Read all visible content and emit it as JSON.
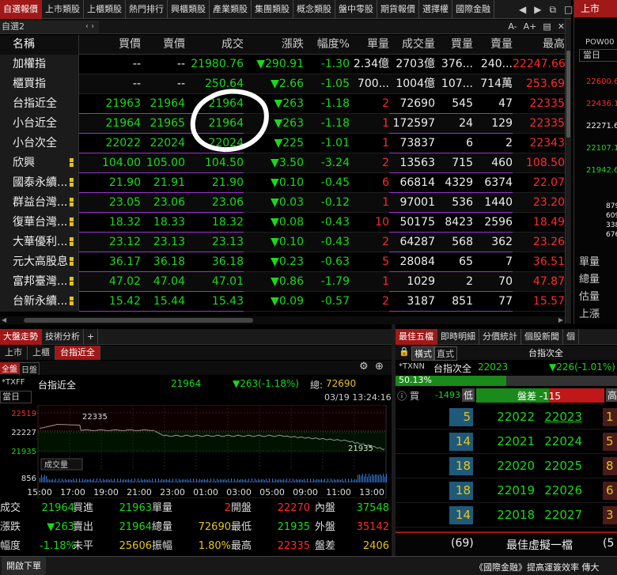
{
  "top_tabs": [
    "自選報價",
    "上市類股",
    "上櫃類股",
    "熱門排行",
    "興櫃類股",
    "產業類股",
    "集團類股",
    "概念類股",
    "盤中零股",
    "期貨報價",
    "選擇權",
    "國際金融"
  ],
  "top_controls": [
    "◀",
    "▶",
    "⧉",
    "□",
    "✕"
  ],
  "sub": {
    "selector": "自選2",
    "nav": "‹ ›",
    "zoom_minus": "A-",
    "zoom_plus": "A+",
    "tools": "▤",
    "close": "✕"
  },
  "quote": {
    "headers": [
      "名稱",
      "買價",
      "賣價",
      "成交",
      "漲跌",
      "幅度%",
      "單量",
      "成交量",
      "買量",
      "賣量",
      "最高"
    ],
    "rows": [
      {
        "name": "加權指",
        "bid": "--",
        "ask": "--",
        "last": "21980.76",
        "chg": "▼290.91",
        "pct": "-1.30",
        "vol": "2.34億",
        "tvol": "2703億",
        "bsz": "376...",
        "asz": "240...",
        "hi": "22247.66",
        "flag": false
      },
      {
        "name": "櫃買指",
        "bid": "--",
        "ask": "--",
        "last": "250.64",
        "chg": "▼2.66",
        "pct": "-1.05",
        "vol": "700...",
        "tvol": "1004億",
        "bsz": "107...",
        "asz": "714萬",
        "hi": "253.69",
        "flag": false
      },
      {
        "name": "台指近全",
        "bid": "21963",
        "ask": "21964",
        "last": "21964",
        "chg": "▼263",
        "pct": "-1.18",
        "vol": "2",
        "tvol": "72690",
        "bsz": "545",
        "asz": "47",
        "hi": "22335",
        "flag": false
      },
      {
        "name": "小台近全",
        "bid": "21964",
        "ask": "21965",
        "last": "21964",
        "chg": "▼263",
        "pct": "-1.18",
        "vol": "1",
        "tvol": "172597",
        "bsz": "24",
        "asz": "129",
        "hi": "22335",
        "flag": false
      },
      {
        "name": "小台次全",
        "bid": "22022",
        "ask": "22024",
        "last": "22024",
        "chg": "▼225",
        "pct": "-1.01",
        "vol": "1",
        "tvol": "73837",
        "bsz": "6",
        "asz": "2",
        "hi": "22343",
        "flag": false
      },
      {
        "name": "欣興",
        "bid": "104.00",
        "ask": "105.00",
        "last": "104.50",
        "chg": "▼3.50",
        "pct": "-3.24",
        "vol": "2",
        "tvol": "13563",
        "bsz": "715",
        "asz": "460",
        "hi": "108.50",
        "flag": true
      },
      {
        "name": "國泰永續...",
        "bid": "21.90",
        "ask": "21.91",
        "last": "21.90",
        "chg": "▼0.10",
        "pct": "-0.45",
        "vol": "6",
        "tvol": "66814",
        "bsz": "4329",
        "asz": "6374",
        "hi": "22.07",
        "flag": true
      },
      {
        "name": "群益台灣...",
        "bid": "23.05",
        "ask": "23.06",
        "last": "23.06",
        "chg": "▼0.03",
        "pct": "-0.12",
        "vol": "1",
        "tvol": "97001",
        "bsz": "536",
        "asz": "1440",
        "hi": "23.20",
        "flag": true
      },
      {
        "name": "復華台灣...",
        "bid": "18.32",
        "ask": "18.33",
        "last": "18.32",
        "chg": "▼0.08",
        "pct": "-0.43",
        "vol": "10",
        "tvol": "50175",
        "bsz": "8423",
        "asz": "2596",
        "hi": "18.49",
        "flag": true
      },
      {
        "name": "大華優利...",
        "bid": "23.12",
        "ask": "23.13",
        "last": "23.13",
        "chg": "▼0.10",
        "pct": "-0.43",
        "vol": "2",
        "tvol": "64287",
        "bsz": "568",
        "asz": "362",
        "hi": "23.26",
        "flag": true
      },
      {
        "name": "元大高股息",
        "bid": "36.17",
        "ask": "36.18",
        "last": "36.18",
        "chg": "▼0.23",
        "pct": "-0.63",
        "vol": "5",
        "tvol": "28084",
        "bsz": "65",
        "asz": "7",
        "hi": "36.51",
        "flag": true
      },
      {
        "name": "富邦臺灣...",
        "bid": "47.02",
        "ask": "47.04",
        "last": "47.01",
        "chg": "▼0.86",
        "pct": "-1.79",
        "vol": "1",
        "tvol": "1029",
        "bsz": "2",
        "asz": "70",
        "hi": "47.87",
        "flag": true
      },
      {
        "name": "台新永續...",
        "bid": "15.42",
        "ask": "15.44",
        "last": "15.43",
        "chg": "▼0.09",
        "pct": "-0.57",
        "vol": "2",
        "tvol": "3187",
        "bsz": "851",
        "asz": "77",
        "hi": "15.57",
        "flag": true
      }
    ]
  },
  "right_panel": {
    "tab": "上市",
    "code": "POW00",
    "period": "當日",
    "prices": [
      "22600.6",
      "22436.1",
      "22271.6",
      "22107.1",
      "21942.6"
    ],
    "small_prices": [
      "879",
      "609",
      "338",
      "676"
    ],
    "labels": [
      "單量",
      "總量",
      "估量",
      "上漲"
    ]
  },
  "lower_left": {
    "tabs": [
      "大盤走勢",
      "技術分析",
      "+"
    ],
    "sub_tabs": [
      "上市",
      "上櫃",
      "台指近全"
    ],
    "sub2": [
      "全盤",
      "日盤"
    ],
    "sym": "*TXFF",
    "period": "當日",
    "name": "台指近全",
    "last": "21964",
    "chg": "▼263(-1.18%)",
    "total_label": "總:",
    "total": "72690",
    "datetime": "03/19  13:24:16",
    "y_labels": [
      "22519",
      "22227",
      "21935",
      "856"
    ],
    "peak_label": "22335",
    "low_label": "21935",
    "vol_label": "成交量",
    "time_labels": [
      "15:00",
      "17:00",
      "19:00",
      "21:00",
      "23:00",
      "01:00",
      "03:00",
      "05:00",
      "09:00",
      "11:00",
      "13:00"
    ],
    "stats": [
      [
        {
          "t": "成交",
          "c": "w"
        },
        {
          "t": "21964",
          "c": "g"
        },
        {
          "t": "買進",
          "c": "w"
        },
        {
          "t": "21963",
          "c": "g"
        },
        {
          "t": "單量",
          "c": "w"
        },
        {
          "t": "2",
          "c": "r"
        },
        {
          "t": "開盤",
          "c": "w"
        },
        {
          "t": "22270",
          "c": "r"
        },
        {
          "t": "內盤",
          "c": "w"
        },
        {
          "t": "37548",
          "c": "g"
        }
      ],
      [
        {
          "t": "漲跌",
          "c": "w"
        },
        {
          "t": "▼263",
          "c": "g"
        },
        {
          "t": "賣出",
          "c": "w"
        },
        {
          "t": "21964",
          "c": "g"
        },
        {
          "t": "總量",
          "c": "w"
        },
        {
          "t": "72690",
          "c": "y"
        },
        {
          "t": "最低",
          "c": "w"
        },
        {
          "t": "21935",
          "c": "g"
        },
        {
          "t": "外盤",
          "c": "w"
        },
        {
          "t": "35142",
          "c": "r"
        }
      ],
      [
        {
          "t": "幅度",
          "c": "w"
        },
        {
          "t": "-1.18%",
          "c": "g"
        },
        {
          "t": "未平",
          "c": "w"
        },
        {
          "t": "25606",
          "c": "y"
        },
        {
          "t": "振幅",
          "c": "w"
        },
        {
          "t": "1.80%",
          "c": "y"
        },
        {
          "t": "最高",
          "c": "w"
        },
        {
          "t": "22335",
          "c": "r"
        },
        {
          "t": "盤差",
          "c": "w"
        },
        {
          "t": "2406",
          "c": "y"
        }
      ]
    ]
  },
  "lower_right": {
    "tabs": [
      "最佳五檔",
      "即時明細",
      "分價統計",
      "個股新聞",
      "個"
    ],
    "mode": [
      "橫式",
      "直式"
    ],
    "title": "台指次全",
    "sym": "*TXNN",
    "name": "台指次全",
    "last": "22023",
    "chg": "▼226(-1.01%)",
    "pct": "50.13%",
    "buy_label": "買",
    "sell_label": "賣",
    "diff_left": "-1493",
    "low_label": "低",
    "diff_label": "盤差 -115",
    "high_label": "高",
    "levels": [
      {
        "bid_qty": "5",
        "bid": "22022",
        "ask": "22023",
        "ask_qty": "1"
      },
      {
        "bid_qty": "14",
        "bid": "22021",
        "ask": "22024",
        "ask_qty": "5"
      },
      {
        "bid_qty": "18",
        "bid": "22020",
        "ask": "22025",
        "ask_qty": "8"
      },
      {
        "bid_qty": "18",
        "bid": "22019",
        "ask": "22026",
        "ask_qty": "6"
      },
      {
        "bid_qty": "14",
        "bid": "22018",
        "ask": "22027",
        "ask_qty": "3"
      }
    ],
    "foot_total": "(69)",
    "foot_label": "最佳虛擬一檔",
    "foot_right": "(5"
  },
  "bottom": {
    "left": "開啟下單",
    "right": "《國際金融》提高運簽效率 傳大"
  },
  "colors": {
    "accent": "#a01818",
    "up": "#ff2a2a",
    "down": "#19d919",
    "qty": "#e6c419"
  }
}
